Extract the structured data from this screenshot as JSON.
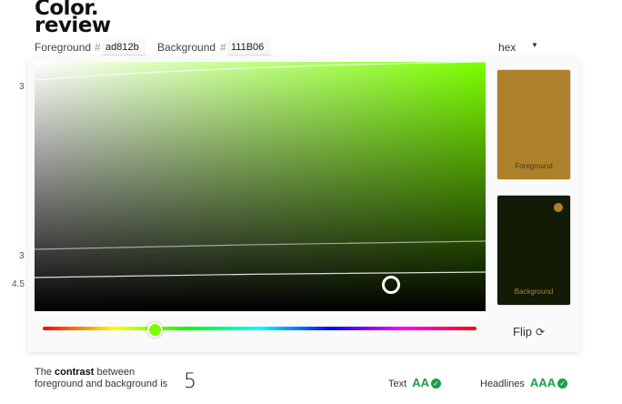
{
  "app": {
    "logo_line1": "Color.",
    "logo_line2": "review"
  },
  "inputs": {
    "foreground_label": "Foreground",
    "foreground_hash": "#",
    "foreground_value": "ad812b",
    "background_label": "Background",
    "background_hash": "#",
    "background_value": "111B06"
  },
  "format": {
    "selected": "hex"
  },
  "colors": {
    "foreground": "#ad812b",
    "background": "#111b06",
    "hue": "#7cff00",
    "accent": "#1a9e4b"
  },
  "picker": {
    "axis_labels": [
      "3",
      "3",
      "4.5"
    ]
  },
  "swatches": {
    "foreground_label": "Foreground",
    "background_label": "Background"
  },
  "hue_slider": {
    "value_color": "#7cff00"
  },
  "flip": {
    "label": "Flip",
    "icon": "refresh-icon"
  },
  "contrast": {
    "text_pre": "The ",
    "text_bold": "contrast",
    "text_post": " between",
    "text_line2": "foreground and background is",
    "value": "5"
  },
  "ratings": {
    "text_label": "Text",
    "text_grade": "AA",
    "headlines_label": "Headlines",
    "headlines_grade": "AAA"
  }
}
